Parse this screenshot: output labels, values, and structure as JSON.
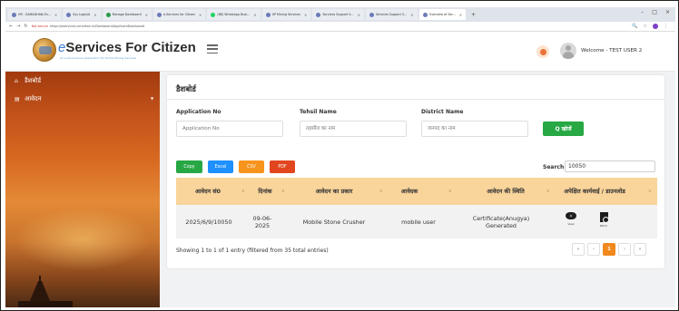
{
  "browser": {
    "tabs": [
      {
        "label": "HR - SAMADHAN-Sh...",
        "active": false
      },
      {
        "label": "Sys Login/A",
        "active": false
      },
      {
        "label": "Manage Dashboard",
        "active": false
      },
      {
        "label": "e-Services for Citizen",
        "active": false
      },
      {
        "label": "(88) WhatsApp Busi...",
        "active": false
      },
      {
        "label": "UP Mining Services",
        "active": false
      },
      {
        "label": "Services Support S...",
        "active": false
      },
      {
        "label": "Services Support S...",
        "active": false
      },
      {
        "label": "Overview of Ser...",
        "active": true
      }
    ],
    "not_secure": "Not secure",
    "url": "https://eservices.uknidhan.in/Dashboard/ApplicantDashboard",
    "window_controls": [
      "–",
      "□",
      "×"
    ]
  },
  "header": {
    "brand_e": "e",
    "brand_name": "Services For Citizen",
    "brand_sub": "An e-Governance Application for Online Mining Services",
    "welcome": "Welcome - TEST USER 2"
  },
  "sidebar": {
    "items": [
      {
        "label": "डैशबोर्ड",
        "icon": "home-icon"
      },
      {
        "label": "आवेदन",
        "icon": "list-icon",
        "has_caret": true
      }
    ]
  },
  "main": {
    "title": "डैशबोर्ड",
    "filters": {
      "application_no_label": "Application No",
      "application_no_placeholder": "Application No",
      "tehsil_label": "Tehsil Name",
      "tehsil_placeholder": "तहसील का नाम",
      "district_label": "District Name",
      "district_placeholder": "जनपद का नाम",
      "search_button": "Q खोजें"
    },
    "export_buttons": [
      {
        "label": "Copy",
        "color": "#28a745"
      },
      {
        "label": "Excel",
        "color": "#1e90ff"
      },
      {
        "label": "CSV",
        "color": "#f7941d"
      },
      {
        "label": "PDF",
        "color": "#e2461f"
      }
    ],
    "search_label": "Search:",
    "search_value": "10050",
    "table": {
      "columns": [
        "आवेदन सं0",
        "दिनांक",
        "आवेदन का प्रकार",
        "आवेदक",
        "आवेदन की स्थिति",
        "अपेक्षित कार्यवाई / डाउनलोड"
      ],
      "rows": [
        {
          "application_no": "2025/6/9/10050",
          "date": "09-06-2025",
          "type": "Mobile Stone Crusher",
          "applicant": "mobile user",
          "status": "Certificate(Anugya) Generated",
          "actions": [
            {
              "label": "View",
              "icon": "eye-icon"
            },
            {
              "label": "Patch",
              "icon": "file-icon"
            }
          ]
        }
      ]
    },
    "showing": "Showing 1 to 1 of 1 entry (filtered from 35 total entries)",
    "pagination": [
      "«",
      "‹",
      "1",
      "›",
      "»"
    ],
    "current_page": "1"
  }
}
